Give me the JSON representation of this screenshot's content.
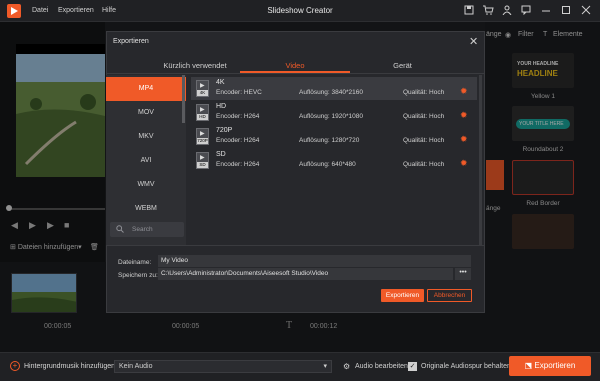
{
  "app": {
    "title": "Slideshow Creator"
  },
  "menu": [
    "Datei",
    "Exportieren",
    "Hilfe"
  ],
  "right_panel": {
    "tabs": [
      "änge",
      "Filter",
      "Elemente"
    ],
    "thumbs": [
      {
        "label": "Yellow 1",
        "headline_top": "YOUR HEADLINE",
        "headline_bottom": "HEADLINE"
      },
      {
        "label": "Roundabout 2",
        "headline_top": "YOUR TITLE HERE"
      },
      {
        "label": "Red Border"
      },
      {
        "label": "änge"
      }
    ]
  },
  "toolbar": {
    "add_files": "Dateien hinzufügen"
  },
  "timeline": {
    "times": [
      "00:00:05",
      "00:00:05",
      "00:00:12"
    ]
  },
  "bottom": {
    "bgm_label": "Hintergrundmusik hinzufügen:",
    "audio_value": "Kein Audio",
    "audio_edit": "Audio bearbeiten",
    "keep_audio": "Originale Audiospur behalten",
    "export": "Exportieren"
  },
  "dialog": {
    "title": "Exportieren",
    "tabs": [
      "Kürzlich verwendet",
      "Video",
      "Gerät"
    ],
    "formats": [
      "MP4",
      "MOV",
      "MKV",
      "AVI",
      "WMV",
      "WEBM"
    ],
    "search_placeholder": "Search",
    "qualities": [
      {
        "name": "4K",
        "tag": "4K",
        "encoder": "Encoder: HEVC",
        "resolution": "Auflösung: 3840*2160",
        "quality": "Qualität: Hoch"
      },
      {
        "name": "HD",
        "tag": "HD",
        "encoder": "Encoder: H264",
        "resolution": "Auflösung: 1920*1080",
        "quality": "Qualität: Hoch"
      },
      {
        "name": "720P",
        "tag": "720P",
        "encoder": "Encoder: H264",
        "resolution": "Auflösung: 1280*720",
        "quality": "Qualität: Hoch"
      },
      {
        "name": "SD",
        "tag": "SD",
        "encoder": "Encoder: H264",
        "resolution": "Auflösung: 640*480",
        "quality": "Qualität: Hoch"
      }
    ],
    "filename_label": "Dateiname:",
    "filename_value": "My Video",
    "path_label": "Speichern zu:",
    "path_value": "C:\\Users\\Administrator\\Documents\\Aiseesoft Studio\\Video",
    "browse": "•••",
    "export": "Exportieren",
    "cancel": "Abbrechen"
  },
  "colors": {
    "accent": "#f05a28",
    "background": "#1e1f22"
  }
}
